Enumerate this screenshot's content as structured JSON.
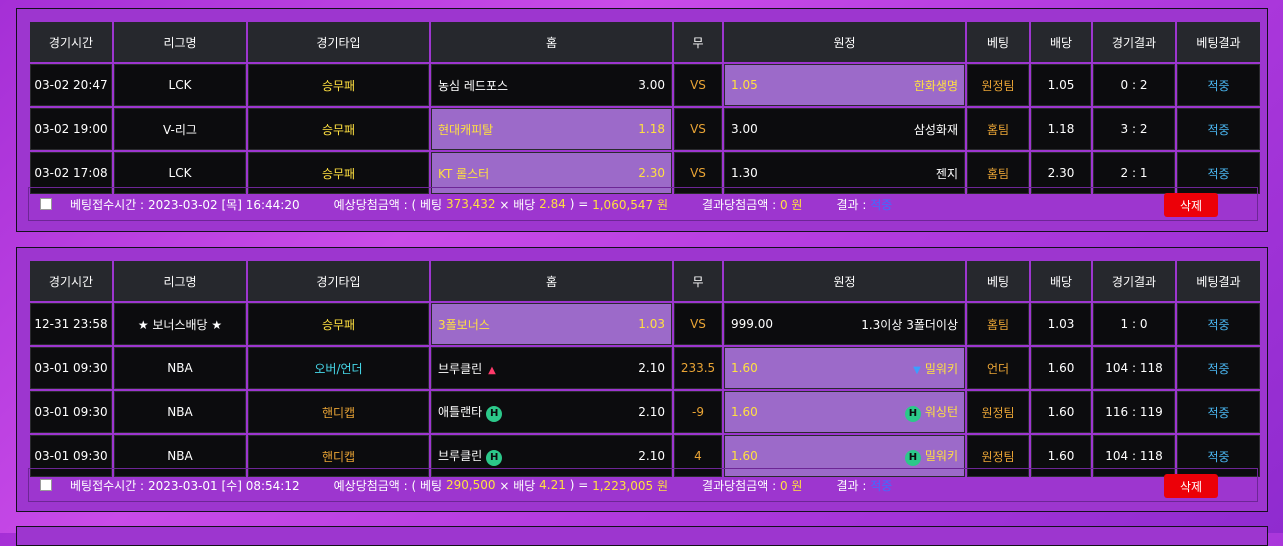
{
  "headers": [
    "경기시간",
    "리그명",
    "경기타입",
    "홈",
    "무",
    "원정",
    "베팅",
    "배당",
    "경기결과",
    "베팅결과"
  ],
  "vs_label": "VS",
  "slips": [
    {
      "rows": [
        {
          "time": "03-02 20:47",
          "league": "LCK",
          "type": "승무패",
          "home": "농심 레드포스",
          "home_odds": "3.00",
          "draw": "VS",
          "away_odds": "1.05",
          "away": "한화생명",
          "selected": "away",
          "bet": "원정팀",
          "odds": "1.05",
          "score": "0 : 2",
          "result": "적중"
        },
        {
          "time": "03-02 19:00",
          "league": "V-리그",
          "type": "승무패",
          "home": "현대캐피탈",
          "home_odds": "1.18",
          "draw": "VS",
          "away_odds": "3.00",
          "away": "삼성화재",
          "selected": "home",
          "bet": "홈팀",
          "odds": "1.18",
          "score": "3 : 2",
          "result": "적중"
        },
        {
          "time": "03-02 17:08",
          "league": "LCK",
          "type": "승무패",
          "home": "KT 롤스터",
          "home_odds": "2.30",
          "draw": "VS",
          "away_odds": "1.30",
          "away": "젠지",
          "selected": "home",
          "bet": "홈팀",
          "odds": "2.30",
          "score": "2 : 1",
          "result": "적중"
        }
      ],
      "footer": {
        "time_label": "베팅접수시간 :",
        "time_value": "2023-03-02 [목] 16:44:20",
        "expected_label": "예상당첨금액 : ( 베팅",
        "bet_amount": "373,432",
        "times": "× 배당",
        "total_odds": "2.84",
        "eq": ") =",
        "expected_value": "1,060,547 원",
        "win_label": "결과당첨금액 :",
        "win_value": "0 원",
        "result_label": "결과 :",
        "result_value": "적중",
        "delete_label": "삭제"
      }
    },
    {
      "rows": [
        {
          "time": "12-31 23:58",
          "league": "★ 보너스배당 ★",
          "type": "승무패",
          "home": "3폴보너스",
          "home_odds": "1.03",
          "draw": "VS",
          "away_odds": "999.00",
          "away": "1.3이상 3폴더이상",
          "selected": "home",
          "bet": "홈팀",
          "odds": "1.03",
          "score": "1 : 0",
          "result": "적중"
        },
        {
          "time": "03-01 09:30",
          "league": "NBA",
          "type": "오버/언더",
          "home": "브루클린",
          "home_odds": "2.10",
          "draw": "233.5",
          "away_odds": "1.60",
          "away": "밀워키",
          "selected": "away",
          "bet": "언더",
          "odds": "1.60",
          "score": "104 : 118",
          "result": "적중"
        },
        {
          "time": "03-01 09:30",
          "league": "NBA",
          "type": "핸디캡",
          "home": "애틀랜타",
          "home_odds": "2.10",
          "draw": "-9",
          "away_odds": "1.60",
          "away": "워싱턴",
          "selected": "away",
          "bet": "원정팀",
          "odds": "1.60",
          "score": "116 : 119",
          "result": "적중"
        },
        {
          "time": "03-01 09:30",
          "league": "NBA",
          "type": "핸디캡",
          "home": "브루클린",
          "home_odds": "2.10",
          "draw": "4",
          "away_odds": "1.60",
          "away": "밀워키",
          "selected": "away",
          "bet": "원정팀",
          "odds": "1.60",
          "score": "104 : 118",
          "result": "적중"
        }
      ],
      "footer": {
        "time_label": "베팅접수시간 :",
        "time_value": "2023-03-01 [수] 08:54:12",
        "expected_label": "예상당첨금액 : ( 베팅",
        "bet_amount": "290,500",
        "times": "× 배당",
        "total_odds": "4.21",
        "eq": ") =",
        "expected_value": "1,223,005 원",
        "win_label": "결과당첨금액 :",
        "win_value": "0 원",
        "result_label": "결과 :",
        "result_value": "적중",
        "delete_label": "삭제"
      }
    }
  ],
  "handicap_badge": "H",
  "colors": {
    "accent": "#9c6ac9",
    "highlight": "#ffe040",
    "win": "#4ab6f0",
    "delete": "#ec0008"
  }
}
